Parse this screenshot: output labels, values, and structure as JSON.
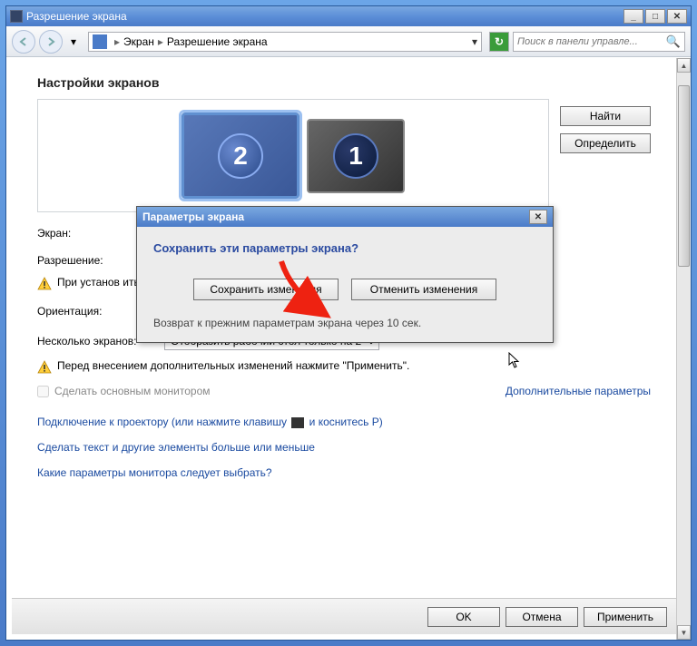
{
  "window": {
    "title": "Разрешение экрана"
  },
  "breadcrumb": {
    "item1": "Экран",
    "item2": "Разрешение экрана"
  },
  "search": {
    "placeholder": "Поиск в панели управле..."
  },
  "heading": "Настройки экранов",
  "sideButtons": {
    "find": "Найти",
    "identify": "Определить"
  },
  "monitors": {
    "selected": "2",
    "other": "1"
  },
  "labels": {
    "screen": "Экран:",
    "resolution": "Разрешение:",
    "orientation": "Ориентация:",
    "multiple": "Несколько экранов:"
  },
  "multiple_value": "Отобразить рабочий стол только на 2",
  "warn1": "При установ                                                                                                                                             иться на экран.",
  "warn2": "Перед внесением дополнительных изменений нажмите \"Применить\".",
  "checkbox_label": "Сделать основным монитором",
  "adv_link": "Дополнительные параметры",
  "links": {
    "l1a": "Подключение к проектору (или нажмите клавишу",
    "l1b": "и коснитесь P)",
    "l2": "Сделать текст и другие элементы больше или меньше",
    "l3": "Какие параметры монитора следует выбрать?"
  },
  "footer": {
    "ok": "OK",
    "cancel": "Отмена",
    "apply": "Применить"
  },
  "dialog": {
    "title": "Параметры экрана",
    "question": "Сохранить эти параметры экрана?",
    "save": "Сохранить изменения",
    "revert": "Отменить изменения",
    "note": "Возврат к прежним параметрам экрана через 10 сек."
  }
}
